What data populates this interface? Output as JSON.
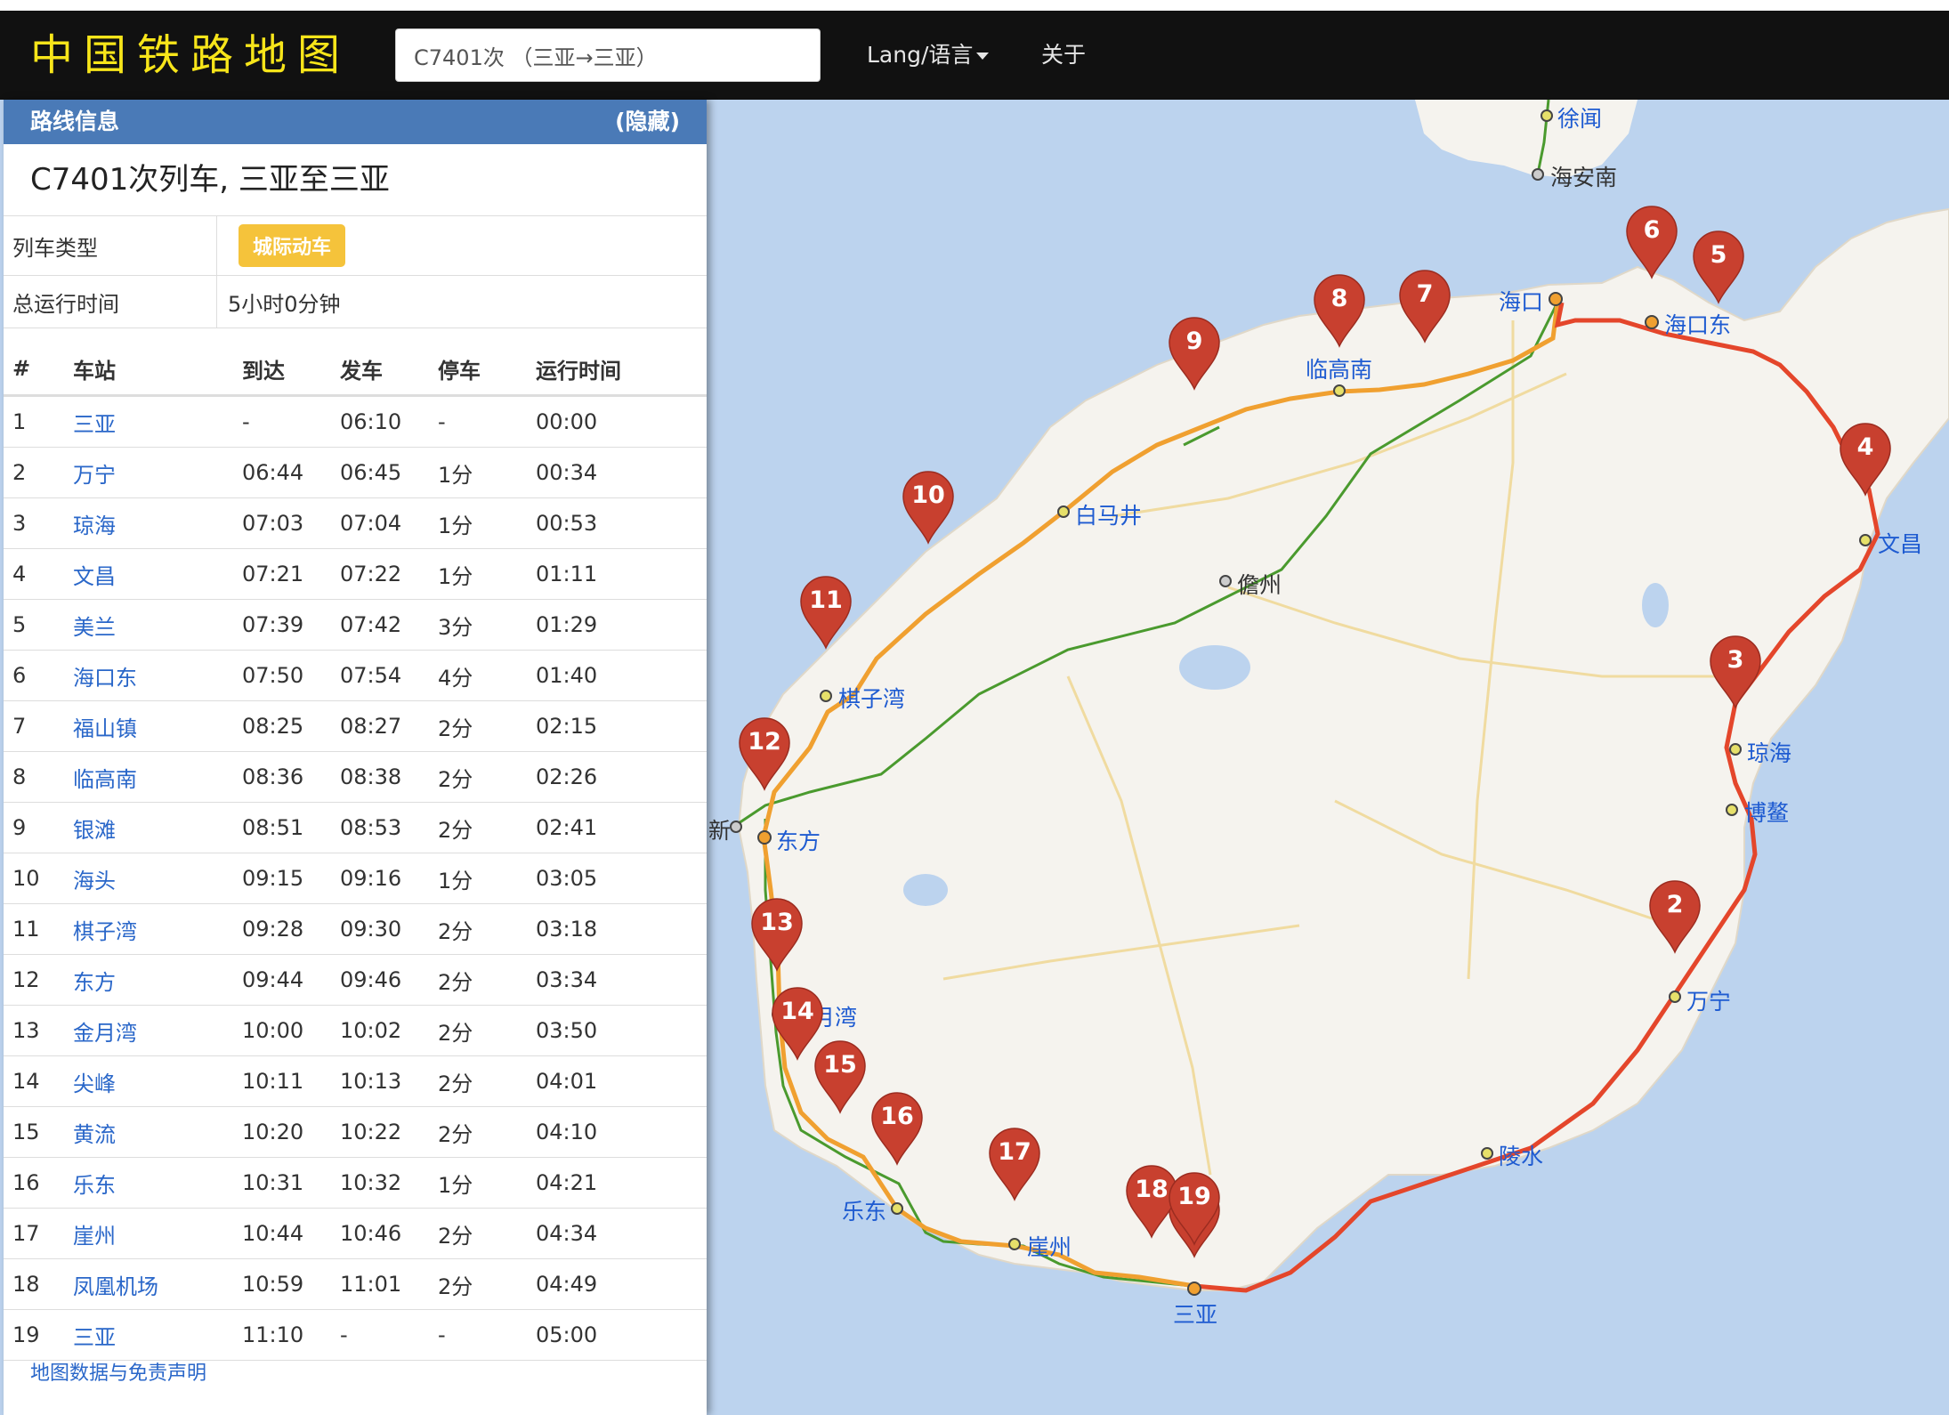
{
  "app": {
    "brand": "中国铁路地图",
    "search_value": "C7401次 （三亚→三亚）",
    "nav_lang": "Lang/语言",
    "nav_about": "关于"
  },
  "panel": {
    "header": "路线信息",
    "hide_label": "(隐藏)",
    "route_title": "C7401次列车, 三亚至三亚",
    "train_type_label": "列车类型",
    "train_type_badge": "城际动车",
    "total_time_label": "总运行时间",
    "total_time_value": "5小时0分钟",
    "columns": [
      "#",
      "车站",
      "到达",
      "发车",
      "停车",
      "运行时间"
    ],
    "rows": [
      [
        "1",
        "三亚",
        "-",
        "06:10",
        "-",
        "00:00"
      ],
      [
        "2",
        "万宁",
        "06:44",
        "06:45",
        "1分",
        "00:34"
      ],
      [
        "3",
        "琼海",
        "07:03",
        "07:04",
        "1分",
        "00:53"
      ],
      [
        "4",
        "文昌",
        "07:21",
        "07:22",
        "1分",
        "01:11"
      ],
      [
        "5",
        "美兰",
        "07:39",
        "07:42",
        "3分",
        "01:29"
      ],
      [
        "6",
        "海口东",
        "07:50",
        "07:54",
        "4分",
        "01:40"
      ],
      [
        "7",
        "福山镇",
        "08:25",
        "08:27",
        "2分",
        "02:15"
      ],
      [
        "8",
        "临高南",
        "08:36",
        "08:38",
        "2分",
        "02:26"
      ],
      [
        "9",
        "银滩",
        "08:51",
        "08:53",
        "2分",
        "02:41"
      ],
      [
        "10",
        "海头",
        "09:15",
        "09:16",
        "1分",
        "03:05"
      ],
      [
        "11",
        "棋子湾",
        "09:28",
        "09:30",
        "2分",
        "03:18"
      ],
      [
        "12",
        "东方",
        "09:44",
        "09:46",
        "2分",
        "03:34"
      ],
      [
        "13",
        "金月湾",
        "10:00",
        "10:02",
        "2分",
        "03:50"
      ],
      [
        "14",
        "尖峰",
        "10:11",
        "10:13",
        "2分",
        "04:01"
      ],
      [
        "15",
        "黄流",
        "10:20",
        "10:22",
        "2分",
        "04:10"
      ],
      [
        "16",
        "乐东",
        "10:31",
        "10:32",
        "1分",
        "04:21"
      ],
      [
        "17",
        "崖州",
        "10:44",
        "10:46",
        "2分",
        "04:34"
      ],
      [
        "18",
        "凤凰机场",
        "10:59",
        "11:01",
        "2分",
        "04:49"
      ],
      [
        "19",
        "三亚",
        "11:10",
        "-",
        "-",
        "05:00"
      ]
    ],
    "footer_note": "地图数据与免责声明"
  },
  "map": {
    "colors": {
      "sea": "#bcd3ee",
      "land": "#f5f3ee",
      "route_east": "#e4462b",
      "route_west": "#f0a030",
      "rail_green": "#4a9a2e",
      "pin": "#c8402f"
    },
    "labels_blue": [
      "徐闻",
      "海口",
      "海口东",
      "临高南",
      "白马井",
      "文昌",
      "棋子湾",
      "琼海",
      "博鳌",
      "东方",
      "万宁",
      "金月湾",
      "陵水",
      "乐东",
      "崖州",
      "三亚"
    ],
    "labels_gray": [
      "海安南",
      "儋州",
      "新"
    ],
    "pins": [
      "1",
      "2",
      "3",
      "4",
      "5",
      "6",
      "7",
      "8",
      "9",
      "10",
      "11",
      "12",
      "13",
      "14",
      "15",
      "16",
      "17",
      "18",
      "19"
    ]
  }
}
